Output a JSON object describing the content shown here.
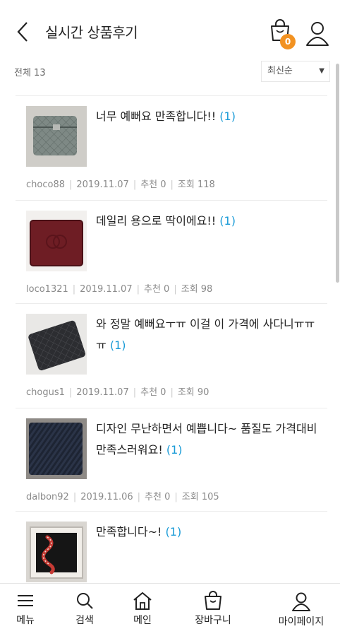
{
  "header": {
    "title": "실시간 상품후기",
    "cart_count": "0"
  },
  "filter": {
    "total_label": "전체 13",
    "sort_selected": "최신순"
  },
  "reviews": [
    {
      "text": "너무 예뻐요 만족합니다!!",
      "count": "(1)",
      "user": "choco88",
      "date": "2019.11.07",
      "recommend": "추천 0",
      "views": "조회 118",
      "thumb": "gray-quilted-wallet"
    },
    {
      "text": "데일리 용으로 딱이에요!!",
      "count": "(1)",
      "user": "loco1321",
      "date": "2019.11.07",
      "recommend": "추천 0",
      "views": "조회 98",
      "thumb": "burgundy-wallet"
    },
    {
      "text": "와 정말 예뻐요ㅜㅠ 이걸 이 가격에 사다니ㅠㅠㅠ",
      "count": "(1)",
      "user": "chogus1",
      "date": "2019.11.07",
      "recommend": "추천 0",
      "views": "조회 90",
      "thumb": "black-quilted-wallet"
    },
    {
      "text": "디자인 무난하면서 예쁩니다~ 품질도 가격대비 만족스러워요!",
      "count": "(1)",
      "user": "dalbon92",
      "date": "2019.11.06",
      "recommend": "추천 0",
      "views": "조회 105",
      "thumb": "woven-navy-wallet"
    },
    {
      "text": "만족합니다~!",
      "count": "(1)",
      "user": "",
      "date": "",
      "recommend": "",
      "views": "",
      "thumb": "snake-wallet-box"
    }
  ],
  "bottom_nav": {
    "menu": "메뉴",
    "search": "검색",
    "main": "메인",
    "cart": "장바구니",
    "mypage": "마이페이지"
  },
  "colors": {
    "accent_badge": "#f29221",
    "count_blue": "#1a9bd7",
    "meta_gray": "#8a8a8a"
  }
}
